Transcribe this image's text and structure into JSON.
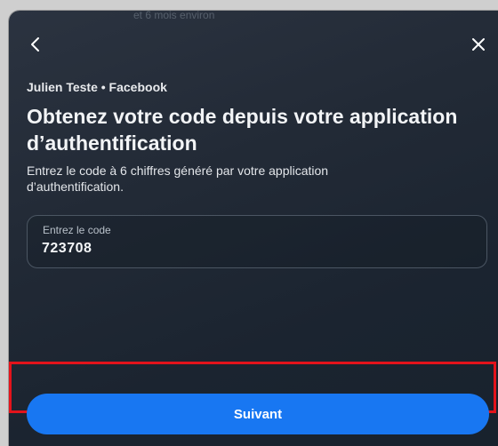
{
  "top_partial_text": "et 6 mois environ",
  "nav": {
    "back_icon": "chevron-left-icon",
    "close_icon": "close-icon"
  },
  "account_line": "Julien Teste • Facebook",
  "title": "Obtenez votre code depuis votre application d’authentification",
  "description": "Entrez le code à 6 chiffres généré par votre application d’authentification.",
  "code_field": {
    "label": "Entrez le code",
    "value": "723708"
  },
  "next_button": {
    "label": "Suivant"
  },
  "colors": {
    "primary_button": "#1877f2",
    "highlight_border": "#e3131b"
  }
}
